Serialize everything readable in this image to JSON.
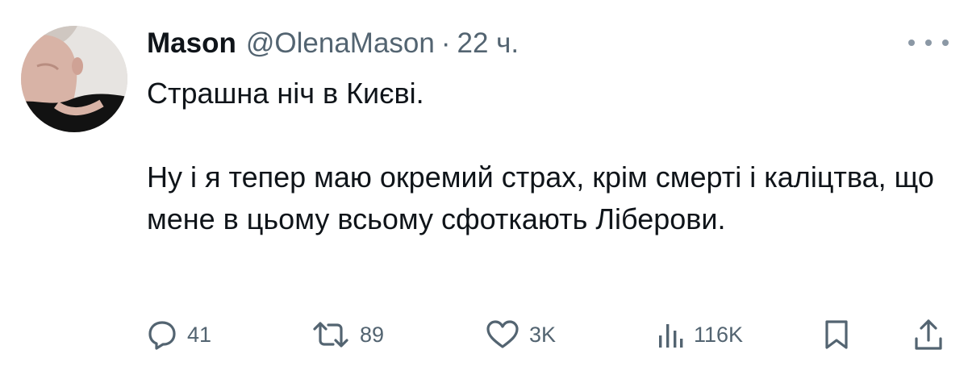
{
  "author": {
    "display_name": "Mason",
    "handle": "@OlenaMason",
    "separator": "·",
    "time": "22 ч."
  },
  "tweet": {
    "paragraphs": [
      "Страшна ніч в Києві.",
      "Ну і я тепер маю окремий страх, крім смерті і каліцтва, що мене в цьому всьому сфоткають Ліберови."
    ]
  },
  "actions": {
    "reply_count": "41",
    "retweet_count": "89",
    "like_count": "3K",
    "views_count": "116K"
  },
  "icons": {
    "avatar": "profile-photo",
    "more": "more-horizontal-icon",
    "reply": "reply-icon",
    "retweet": "retweet-icon",
    "like": "heart-icon",
    "views": "bar-chart-icon",
    "bookmark": "bookmark-icon",
    "share": "share-icon"
  },
  "colors": {
    "text": "#0f1419",
    "secondary": "#536471",
    "background": "#ffffff"
  }
}
